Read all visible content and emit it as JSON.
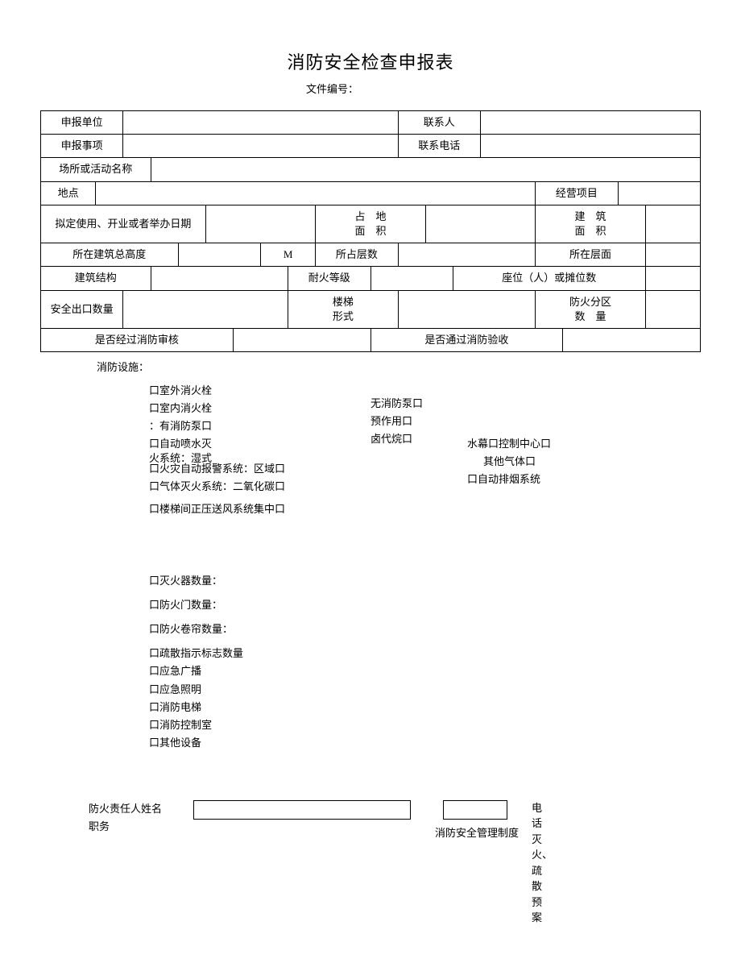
{
  "title": "消防安全检查申报表",
  "docnum_label": "文件编号：",
  "rows": {
    "r1c1": "申报单位",
    "r1c2": "联系人",
    "r2c1": "申报事项",
    "r2c2": "联系电话",
    "r3c1": "场所或活动名称",
    "r4c1": "地点",
    "r4c2": "经营项目",
    "r5c1": "拟定使用、开业或者举办日期",
    "r5c2": "占　地\n面　积",
    "r5c3": "建　筑\n面　积",
    "r6c1": "所在建筑总高度",
    "r6c2": "M",
    "r6c3": "所占层数",
    "r6c4": "所在层面",
    "r7c1": "建筑结构",
    "r7c2": "耐火等级",
    "r7c3": "座位（人）或摊位数",
    "r8c1": "安全出口数量",
    "r8c2": "楼梯\n形式",
    "r8c3": "防火分区\n数　量",
    "r9c1": "是否经过消防审核",
    "r9c2": "是否通过消防验收"
  },
  "facilities_label": "消防设施：",
  "col_a": [
    "口室外消火栓",
    "口室内消火栓",
    "：有消防泵口",
    "口自动喷水灭",
    "火系统：湿式",
    "口火灾自动报警系统：区域口",
    "口气体灭火系统：二氧化碳口",
    "口楼梯间正压送风系统集中口"
  ],
  "col_b": [
    "无消防泵口",
    "预作用口",
    "",
    "卤代烷口"
  ],
  "col_c": [
    "水幕口控制中心口",
    "其他气体口",
    "口自动排烟系统"
  ],
  "list2": [
    "口灭火器数量：",
    "口防火门数量：",
    "口防火卷帘数量：",
    "口疏散指示标志数量",
    "口应急广播",
    "",
    "口应急照明",
    "口消防电梯",
    "",
    "口消防控制室",
    "口其他设备"
  ],
  "bottom": {
    "resp": "防火责任人姓名\n职务",
    "mgmt": "消防安全管理制度",
    "side": "电话\n灭火、疏散预案"
  }
}
